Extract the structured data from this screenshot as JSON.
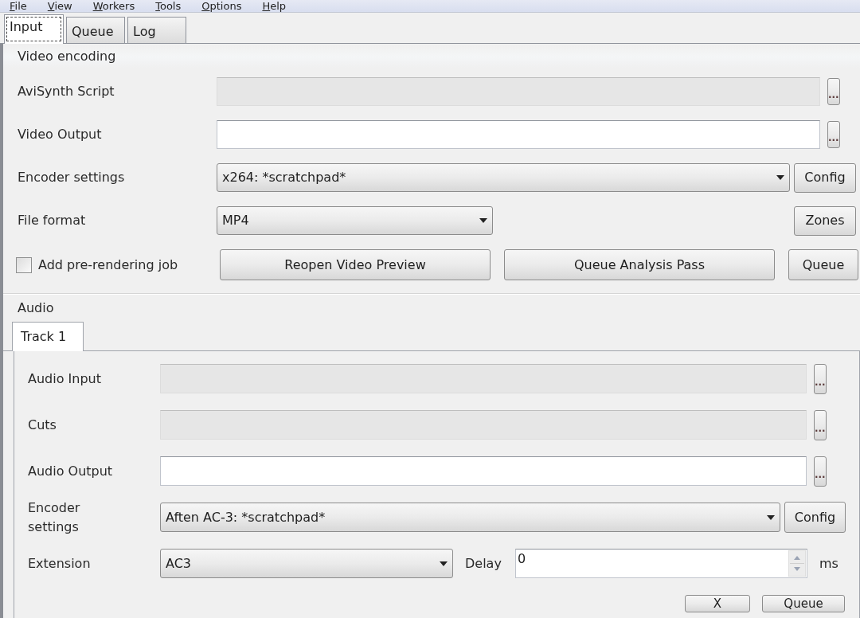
{
  "menu_bar": [
    "File",
    "View",
    "Workers",
    "Tools",
    "Options",
    "Help"
  ],
  "tabs": [
    {
      "label": "Input",
      "selected": true
    },
    {
      "label": "Queue",
      "selected": false
    },
    {
      "label": "Log",
      "selected": false
    }
  ],
  "video_encoding": {
    "title": "Video encoding",
    "rows": [
      {
        "kind": "file",
        "label": "AviSynth Script",
        "disabled": true,
        "browse": "..."
      },
      {
        "kind": "file",
        "label": "Video Output",
        "disabled": false,
        "browse": "..."
      },
      {
        "kind": "combo",
        "label": "Encoder settings",
        "value": "x264: *scratchpad*",
        "button": "Config"
      },
      {
        "kind": "short_combo",
        "label": "File format",
        "value": "MP4",
        "button": "Zones"
      }
    ],
    "pre_rendering": {
      "label": "Add pre-rendering job",
      "checked": false
    },
    "buttons": [
      "Reopen Video Preview",
      "Queue Analysis Pass",
      "Queue"
    ]
  },
  "audio": {
    "title": "Audio",
    "tabs": [
      {
        "label": "Track 1",
        "selected": true
      }
    ],
    "rows": [
      {
        "kind": "file",
        "label": "Audio Input",
        "disabled": true,
        "browse": "..."
      },
      {
        "kind": "file",
        "label": "Cuts",
        "disabled": true,
        "browse": "..."
      },
      {
        "kind": "file",
        "label": "Audio Output",
        "disabled": false,
        "browse": "..."
      },
      {
        "kind": "combo",
        "label": "Encoder settings",
        "value": "Aften AC-3: *scratchpad*",
        "button": "Config"
      }
    ],
    "extension": {
      "label": "Extension",
      "value": "AC3"
    },
    "delay": {
      "label": "Delay",
      "value": "0",
      "unit": "ms"
    }
  },
  "bottom_buttons": [
    "X",
    "Queue"
  ]
}
